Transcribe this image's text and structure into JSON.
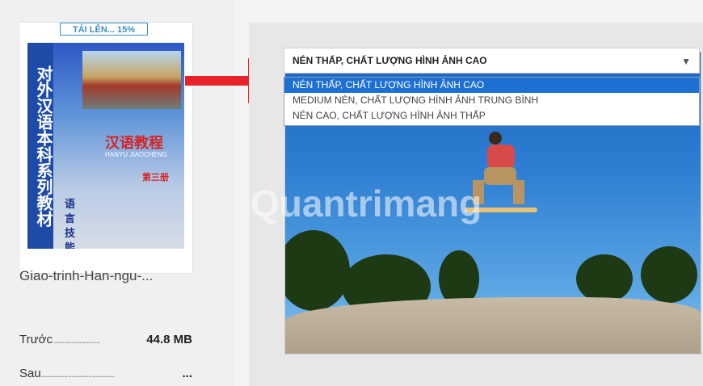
{
  "upload": {
    "badge": "TẢI LÊN... 15%",
    "file_name": "Giao-trinh-Han-ngu-...",
    "before_label": "Trước",
    "before_value": "44.8 MB",
    "after_label": "Sau",
    "after_value": "...",
    "cover": {
      "vertical_title": "对外汉语本科系列教材",
      "chinese_title": "汉语教程",
      "pinyin": "HANYU JIAOCHENG",
      "volume": "第三册",
      "subtitle": "语言技能"
    }
  },
  "compression": {
    "selected": "NÉN THẤP, CHẤT LƯỢNG HÌNH ẢNH CAO",
    "options": [
      "NÉN THẤP, CHẤT LƯỢNG HÌNH ẢNH CAO",
      "MEDIUM NÉN, CHẤT LƯỢNG HÌNH ẢNH TRUNG BÌNH",
      "NÉN CAO, CHẤT LƯỢNG HÌNH ẢNH THẤP"
    ]
  },
  "watermark": "Quantrimang",
  "colors": {
    "accent": "#1e6fd2",
    "badge": "#3b8fc2",
    "arrow": "#e8222a"
  }
}
